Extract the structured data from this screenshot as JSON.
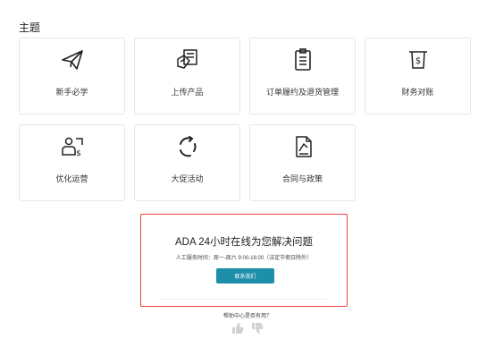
{
  "section": {
    "title": "主题"
  },
  "cards": [
    {
      "label": "新手必学",
      "icon": "paper-plane-icon"
    },
    {
      "label": "上传产品",
      "icon": "upload-box-icon"
    },
    {
      "label": "订单履约及退货管理",
      "icon": "clipboard-list-icon"
    },
    {
      "label": "财务对账",
      "icon": "receipt-dollar-icon"
    },
    {
      "label": "优化运营",
      "icon": "user-dollar-icon"
    },
    {
      "label": "大促活动",
      "icon": "refresh-circle-icon"
    },
    {
      "label": "合同与政策",
      "icon": "document-contract-icon"
    }
  ],
  "help": {
    "title": "ADA 24小时在线为您解决问题",
    "hours": "人工服务时间：周一-周六 9:00-18:00（法定节假日除外）",
    "contact_label": "联系我们"
  },
  "feedback": {
    "question": "帮助中心是否有用？"
  },
  "colors": {
    "accent": "#1e8fa8",
    "highlight_border": "#e8433a",
    "icon_stroke": "#222222"
  }
}
